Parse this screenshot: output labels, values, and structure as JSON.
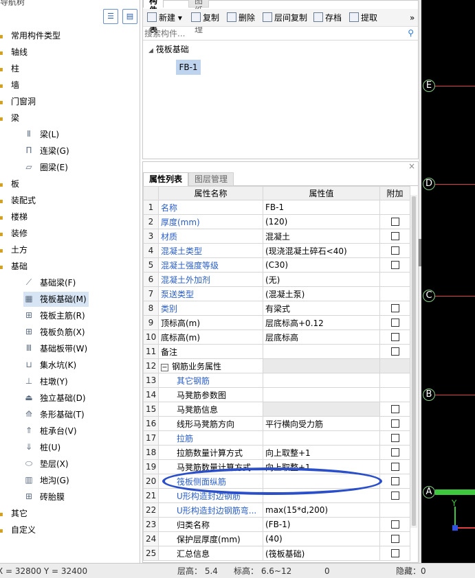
{
  "nav": {
    "title": "导航树",
    "items": [
      {
        "label": "常用构件类型"
      },
      {
        "label": "轴线"
      },
      {
        "label": "柱"
      },
      {
        "label": "墙"
      },
      {
        "label": "门窗洞"
      },
      {
        "label": "梁"
      },
      {
        "label": "梁(L)"
      },
      {
        "label": "连梁(G)"
      },
      {
        "label": "圈梁(E)"
      },
      {
        "label": "板"
      },
      {
        "label": "装配式"
      },
      {
        "label": "楼梯"
      },
      {
        "label": "装修"
      },
      {
        "label": "土方"
      },
      {
        "label": "基础"
      },
      {
        "label": "基础梁(F)"
      },
      {
        "label": "筏板基础(M)"
      },
      {
        "label": "筏板主筋(R)"
      },
      {
        "label": "筏板负筋(X)"
      },
      {
        "label": "基础板带(W)"
      },
      {
        "label": "集水坑(K)"
      },
      {
        "label": "柱墩(Y)"
      },
      {
        "label": "独立基础(D)"
      },
      {
        "label": "条形基础(T)"
      },
      {
        "label": "桩承台(V)"
      },
      {
        "label": "桩(U)"
      },
      {
        "label": "垫层(X)"
      },
      {
        "label": "地沟(G)"
      },
      {
        "label": "砖胎膜"
      },
      {
        "label": "其它"
      },
      {
        "label": "自定义"
      }
    ]
  },
  "component_panel": {
    "tabs": [
      "构件列表",
      "图纸管理"
    ],
    "toolbar": {
      "new": "新建",
      "copy": "复制",
      "delete": "删除",
      "floor_copy": "层间复制",
      "archive": "存档",
      "extract": "提取",
      "more": "»"
    },
    "search_placeholder": "搜索构件...",
    "tree_root": "筏板基础",
    "tree_leaf": "FB-1"
  },
  "property_panel": {
    "tabs": [
      "属性列表",
      "图层管理"
    ],
    "close": "×",
    "headers": {
      "name": "属性名称",
      "value": "属性值",
      "extra": "附加"
    },
    "rows": [
      {
        "n": "1",
        "name": "名称",
        "value": "FB-1"
      },
      {
        "n": "2",
        "name": "厚度(mm)",
        "value": "(120)"
      },
      {
        "n": "3",
        "name": "材质",
        "value": "混凝土"
      },
      {
        "n": "4",
        "name": "混凝土类型",
        "value": "(现浇混凝土碎石<40)"
      },
      {
        "n": "5",
        "name": "混凝土强度等级",
        "value": "(C30)"
      },
      {
        "n": "6",
        "name": "混凝土外加剂",
        "value": "(无)"
      },
      {
        "n": "7",
        "name": "泵送类型",
        "value": "(混凝土泵)"
      },
      {
        "n": "8",
        "name": "类别",
        "value": "有梁式"
      },
      {
        "n": "9",
        "name": "顶标高(m)",
        "value": "层底标高+0.12"
      },
      {
        "n": "10",
        "name": "底标高(m)",
        "value": "层底标高"
      },
      {
        "n": "11",
        "name": "备注",
        "value": ""
      },
      {
        "n": "12",
        "name": "钢筋业务属性",
        "value": "",
        "expand": "−"
      },
      {
        "n": "13",
        "name": "其它钢筋",
        "value": ""
      },
      {
        "n": "14",
        "name": "马凳筋参数图",
        "value": ""
      },
      {
        "n": "15",
        "name": "马凳筋信息",
        "value": ""
      },
      {
        "n": "16",
        "name": "线形马凳筋方向",
        "value": "平行横向受力筋"
      },
      {
        "n": "17",
        "name": "拉筋",
        "value": ""
      },
      {
        "n": "18",
        "name": "拉筋数量计算方式",
        "value": "向上取整+1"
      },
      {
        "n": "19",
        "name": "马凳筋数量计算方式",
        "value": "向上取整+1"
      },
      {
        "n": "20",
        "name": "筏板侧面纵筋",
        "value": ""
      },
      {
        "n": "21",
        "name": "U形构造封边钢筋",
        "value": ""
      },
      {
        "n": "22",
        "name": "U形构造封边钢筋弯...",
        "value": "max(15*d,200)"
      },
      {
        "n": "23",
        "name": "归类名称",
        "value": "(FB-1)"
      },
      {
        "n": "24",
        "name": "保护层厚度(mm)",
        "value": "(40)"
      },
      {
        "n": "25",
        "name": "汇总信息",
        "value": "(筏板基础)"
      }
    ]
  },
  "canvas": {
    "axes": [
      "E",
      "D",
      "C",
      "B",
      "A"
    ],
    "y_label": "Y",
    "colors": {
      "axis_line": "#e04040",
      "axis_circle": "#8ad08a",
      "beam": "#3ec83e",
      "highlight_ellipse": "#2a4fc8"
    }
  },
  "status_bar": {
    "coords": "X = 32800 Y = 32400",
    "floor_height": "层高：  5.4",
    "elevation": "标高：  6.6~12",
    "count": "0",
    "hidden": "隐藏：0"
  }
}
